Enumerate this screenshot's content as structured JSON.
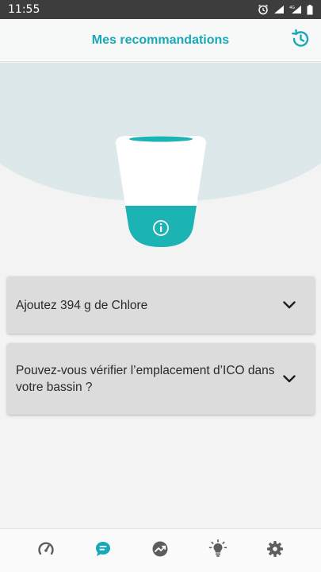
{
  "status_bar": {
    "time": "11:55",
    "icons": [
      "alarm-icon",
      "wifi-icon",
      "signal-4g-icon",
      "battery-icon"
    ]
  },
  "header": {
    "title": "Mes recommandations",
    "history_icon": "history-icon"
  },
  "hero": {
    "device_icon": "info-icon",
    "colors": {
      "teal": "#1bb3b4",
      "arc": "#dde8ea"
    }
  },
  "recommendations": [
    {
      "text": "Ajoutez 394 g de Chlore",
      "icon": "chevron-down-icon"
    },
    {
      "text": "Pouvez-vous vérifier l’emplacement d’ICO dans votre bassin ?",
      "icon": "chevron-down-icon"
    }
  ],
  "bottom_nav": {
    "items": [
      {
        "icon": "speedometer-icon",
        "active": false
      },
      {
        "icon": "chat-icon",
        "active": true
      },
      {
        "icon": "trend-icon",
        "active": false
      },
      {
        "icon": "lightbulb-icon",
        "active": false
      },
      {
        "icon": "gear-icon",
        "active": false
      }
    ],
    "active_color": "#17a9b9",
    "inactive_color": "#5d5d5d"
  }
}
